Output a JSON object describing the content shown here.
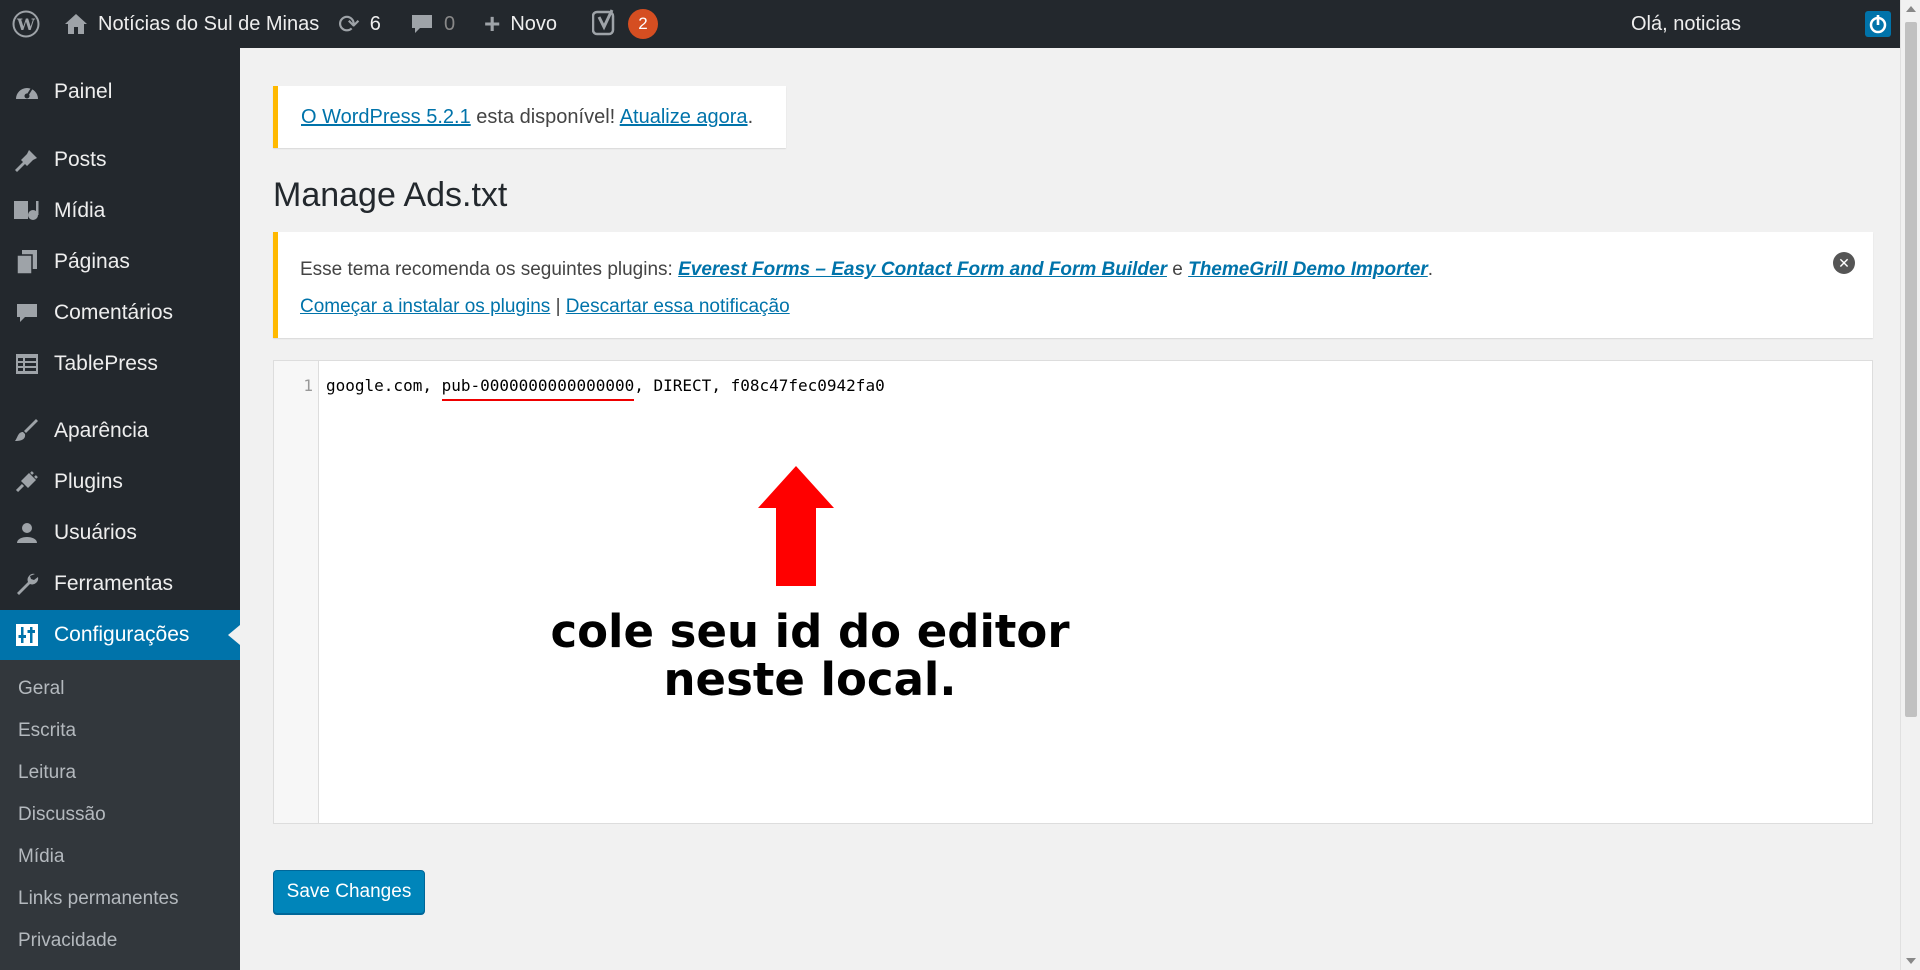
{
  "admin_bar": {
    "site_name": "Notícias do Sul de Minas",
    "updates_count": "6",
    "comments_count": "0",
    "new_label": "Novo",
    "yoast_badge": "2",
    "greeting": "Olá, noticias"
  },
  "sidebar": {
    "items": [
      {
        "label": "Painel",
        "icon": "dashboard-icon"
      },
      {
        "label": "Posts",
        "icon": "pin-icon"
      },
      {
        "label": "Mídia",
        "icon": "media-icon"
      },
      {
        "label": "Páginas",
        "icon": "pages-icon"
      },
      {
        "label": "Comentários",
        "icon": "comment-icon"
      },
      {
        "label": "TablePress",
        "icon": "table-icon"
      },
      {
        "label": "Aparência",
        "icon": "brush-icon"
      },
      {
        "label": "Plugins",
        "icon": "plug-icon"
      },
      {
        "label": "Usuários",
        "icon": "user-icon"
      },
      {
        "label": "Ferramentas",
        "icon": "wrench-icon"
      },
      {
        "label": "Configurações",
        "icon": "settings-icon",
        "current": true
      }
    ],
    "submenu": [
      "Geral",
      "Escrita",
      "Leitura",
      "Discussão",
      "Mídia",
      "Links permanentes",
      "Privacidade"
    ]
  },
  "update_notice": {
    "link1": "O WordPress 5.2.1",
    "text": " esta disponível! ",
    "link2": "Atualize agora",
    "end": "."
  },
  "page_title": "Manage Ads.txt",
  "plugin_notice": {
    "prefix": "Esse tema recomenda os seguintes plugins: ",
    "plugin1": "Everest Forms – Easy Contact Form and Form Builder",
    "conj": " e ",
    "plugin2": "ThemeGrill Demo Importer",
    "end": ".",
    "install_link": "Começar a instalar os plugins",
    "separator": " | ",
    "dismiss_link": "Descartar essa notificação"
  },
  "editor": {
    "line_number": "1",
    "line_prefix": "google.com, ",
    "pub_id": "pub-0000000000000000",
    "line_suffix": ", DIRECT, f08c47fec0942fa0"
  },
  "annotation": {
    "line1": "cole seu id do editor",
    "line2": "neste local."
  },
  "save_button": "Save Changes",
  "colors": {
    "admin_dark": "#23282d",
    "accent_blue": "#0073aa",
    "notice_yellow": "#ffb900",
    "badge_orange": "#d54e21",
    "annotation_red": "#ff0000"
  }
}
